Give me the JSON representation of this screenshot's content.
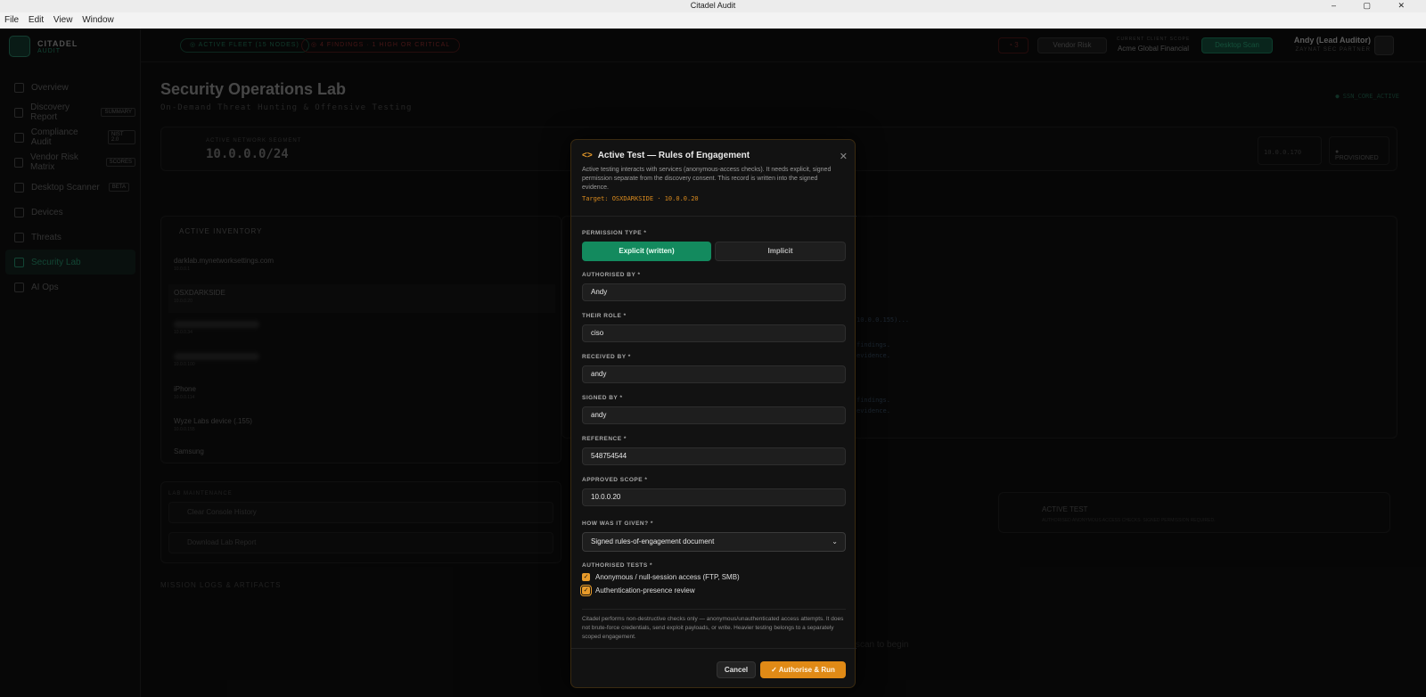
{
  "window": {
    "title": "Citadel Audit",
    "controls": "– ▢ ✕"
  },
  "menu": [
    "File",
    "Edit",
    "View",
    "Window"
  ],
  "brand": {
    "name": "CITADEL",
    "sub": "AUDIT"
  },
  "sidebar": {
    "items": [
      {
        "label": "Overview",
        "badge": ""
      },
      {
        "label": "Discovery Report",
        "badge": "SUMMARY"
      },
      {
        "label": "Compliance Audit",
        "badge": "NIST 2.0"
      },
      {
        "label": "Vendor Risk Matrix",
        "badge": "SCORES"
      },
      {
        "label": "Desktop Scanner",
        "badge": "BETA"
      },
      {
        "label": "Devices",
        "badge": ""
      },
      {
        "label": "Threats",
        "badge": ""
      },
      {
        "label": "Security Lab",
        "badge": ""
      },
      {
        "label": "AI Ops",
        "badge": ""
      }
    ]
  },
  "topbar": {
    "fleet": "◎ ACTIVE FLEET (15 NODES)",
    "findings": "◎ 4 FINDINGS · 1 HIGH OR CRITICAL",
    "bell_count": "3",
    "vendor_risk": "Vendor Risk",
    "client_label": "CURRENT CLIENT SCOPE",
    "client_name": "Acme Global Financial",
    "desktop_scan": "Desktop Scan",
    "user_name": "Andy (Lead Auditor)",
    "user_role": "ZAYNAT SEC PARTNER"
  },
  "page": {
    "title": "Security Operations Lab",
    "subtitle": "On-Demand Threat Hunting & Offensive Testing",
    "session": "● SSN_CORE_ACTIVE"
  },
  "network": {
    "label": "ACTIVE NETWORK SEGMENT",
    "value": "10.0.0.0/24",
    "stat1": "10.0.0.170",
    "stat2": "● PROVISIONED"
  },
  "inventory": {
    "title": "ACTIVE INVENTORY",
    "rows": [
      {
        "name": "darklab.mynetworksettings.com",
        "ip": "10.0.0.1"
      },
      {
        "name": "OSXDARKSIDE",
        "ip": "10.0.0.20"
      },
      {
        "name": "",
        "ip": "10.0.0.34"
      },
      {
        "name": "",
        "ip": "10.0.0.100"
      },
      {
        "name": "iPhone",
        "ip": "10.0.0.114"
      },
      {
        "name": "Wyze Labs device (.155)",
        "ip": "10.0.0.155"
      },
      {
        "name": "Samsung",
        "ip": ""
      }
    ]
  },
  "console": {
    "lines": [
      "10.0.0.155)...",
      "findings.",
      "evidence.",
      "findings.",
      "evidence."
    ]
  },
  "maintenance": {
    "title": "LAB MAINTENANCE",
    "clear": "Clear Console History",
    "download": "Download Lab Report"
  },
  "active_test_card": {
    "title": "ACTIVE TEST",
    "desc": "AUTHORISED ANONYMOUS ACCESS CHECKS. SIGNED PERMISSION REQUIRED.",
    "target": "TARGET: 10.0.0.20"
  },
  "mission": "MISSION LOGS & ARTIFACTS",
  "scan_hint": "scan to begin",
  "modal": {
    "title": "Active Test — Rules of Engagement",
    "description": "Active testing interacts with services (anonymous-access checks). It needs explicit, signed permission separate from the discovery consent. This record is written into the signed evidence.",
    "target": "Target: OSXDARKSIDE · 10.0.0.20",
    "permission_type_label": "PERMISSION TYPE *",
    "permission_explicit": "Explicit (written)",
    "permission_implicit": "Implicit",
    "authorised_by_label": "AUTHORISED BY *",
    "authorised_by": "Andy",
    "role_label": "THEIR ROLE *",
    "role": "ciso",
    "received_by_label": "RECEIVED BY *",
    "received_by": "andy",
    "signed_by_label": "SIGNED BY *",
    "signed_by": "andy",
    "reference_label": "REFERENCE *",
    "reference": "548754544",
    "scope_label": "APPROVED SCOPE *",
    "scope": "10.0.0.20",
    "how_label": "HOW WAS IT GIVEN? *",
    "how": "Signed rules-of-engagement document",
    "tests_label": "AUTHORISED TESTS *",
    "test1": "Anonymous / null-session access (FTP, SMB)",
    "test2": "Authentication-presence review",
    "note": "Citadel performs non-destructive checks only — anonymous/unauthenticated access attempts. It does not brute-force credentials, send exploit payloads, or write. Heavier testing belongs to a separately scoped engagement.",
    "cancel": "Cancel",
    "run": "✓  Authorise & Run"
  },
  "colors": {
    "accent_green": "#138a5e",
    "accent_orange": "#e08a16"
  }
}
